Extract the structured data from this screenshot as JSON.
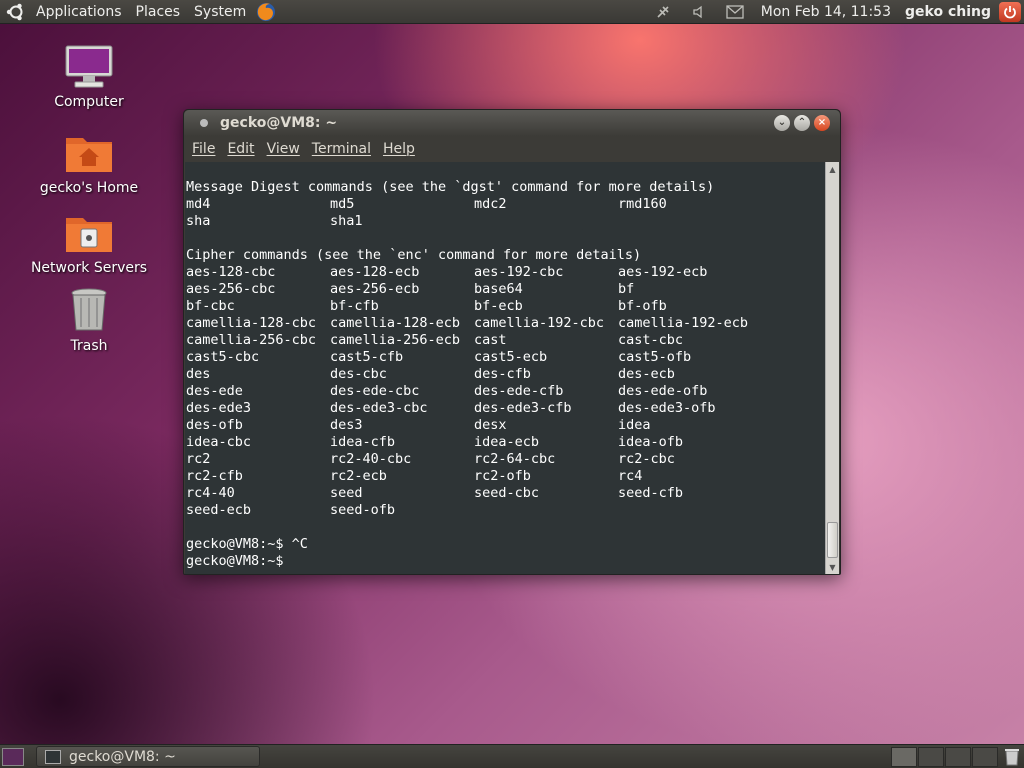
{
  "top_panel": {
    "menus": [
      "Applications",
      "Places",
      "System"
    ],
    "clock": "Mon Feb 14, 11:53",
    "username": "geko ching"
  },
  "desktop_icons": [
    {
      "label": "Computer",
      "icon": "computer-icon"
    },
    {
      "label": "gecko's Home",
      "icon": "home-folder-icon"
    },
    {
      "label": "Network Servers",
      "icon": "network-folder-icon"
    },
    {
      "label": "Trash",
      "icon": "trash-icon"
    }
  ],
  "terminal": {
    "title": "gecko@VM8: ~",
    "menu": [
      "File",
      "Edit",
      "View",
      "Terminal",
      "Help"
    ],
    "lines": [
      {
        "text": "Message Digest commands (see the `dgst' command for more details)"
      },
      {
        "cols": [
          "md4",
          "md5",
          "mdc2",
          "rmd160"
        ]
      },
      {
        "cols": [
          "sha",
          "sha1"
        ]
      },
      {
        "text": ""
      },
      {
        "text": "Cipher commands (see the `enc' command for more details)"
      },
      {
        "cols": [
          "aes-128-cbc",
          "aes-128-ecb",
          "aes-192-cbc",
          "aes-192-ecb"
        ]
      },
      {
        "cols": [
          "aes-256-cbc",
          "aes-256-ecb",
          "base64",
          "bf"
        ]
      },
      {
        "cols": [
          "bf-cbc",
          "bf-cfb",
          "bf-ecb",
          "bf-ofb"
        ]
      },
      {
        "cols": [
          "camellia-128-cbc",
          "camellia-128-ecb",
          "camellia-192-cbc",
          "camellia-192-ecb"
        ]
      },
      {
        "cols": [
          "camellia-256-cbc",
          "camellia-256-ecb",
          "cast",
          "cast-cbc"
        ]
      },
      {
        "cols": [
          "cast5-cbc",
          "cast5-cfb",
          "cast5-ecb",
          "cast5-ofb"
        ]
      },
      {
        "cols": [
          "des",
          "des-cbc",
          "des-cfb",
          "des-ecb"
        ]
      },
      {
        "cols": [
          "des-ede",
          "des-ede-cbc",
          "des-ede-cfb",
          "des-ede-ofb"
        ]
      },
      {
        "cols": [
          "des-ede3",
          "des-ede3-cbc",
          "des-ede3-cfb",
          "des-ede3-ofb"
        ]
      },
      {
        "cols": [
          "des-ofb",
          "des3",
          "desx",
          "idea"
        ]
      },
      {
        "cols": [
          "idea-cbc",
          "idea-cfb",
          "idea-ecb",
          "idea-ofb"
        ]
      },
      {
        "cols": [
          "rc2",
          "rc2-40-cbc",
          "rc2-64-cbc",
          "rc2-cbc"
        ]
      },
      {
        "cols": [
          "rc2-cfb",
          "rc2-ecb",
          "rc2-ofb",
          "rc4"
        ]
      },
      {
        "cols": [
          "rc4-40",
          "seed",
          "seed-cbc",
          "seed-cfb"
        ]
      },
      {
        "cols": [
          "seed-ecb",
          "seed-ofb"
        ]
      },
      {
        "text": ""
      },
      {
        "text": "gecko@VM8:~$ ^C"
      },
      {
        "text": "gecko@VM8:~$ "
      }
    ]
  },
  "taskbar": {
    "task_label": "gecko@VM8: ~"
  },
  "colors": {
    "terminal_bg": "#2e3436",
    "terminal_fg": "#ffffff",
    "panel_bg": "#3c3b37"
  }
}
